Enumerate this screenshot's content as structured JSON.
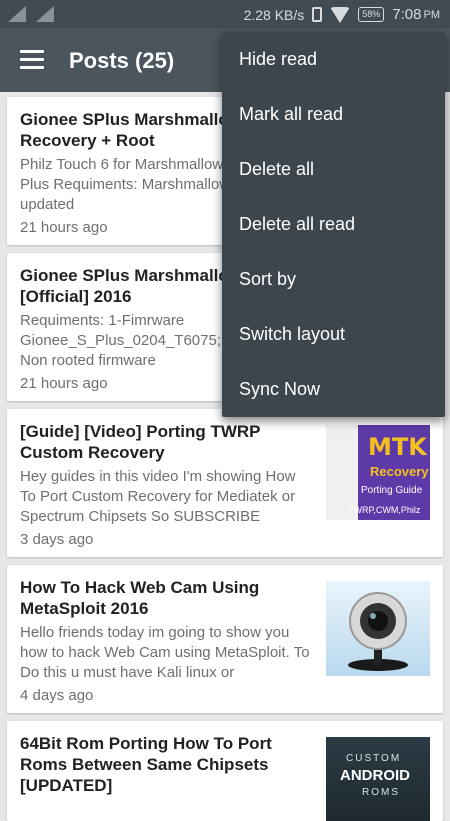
{
  "status_bar": {
    "speed": "2.28 KB/s",
    "battery": "58%",
    "time": "7:08",
    "ampm": "PM"
  },
  "app_bar": {
    "title": "Posts (25)"
  },
  "posts": [
    {
      "title": "Gionee SPlus Marshmallow Touch Recovery + Root",
      "excerpt": "Philz Touch 6 for Marshmallow Gionee S Plus Requiments: Marshmallow device updated",
      "time": "21 hours ago"
    },
    {
      "title": "Gionee SPlus Marshmallow [Official] 2016",
      "excerpt": "Requiments: 1-Fimrware Gionee_S_Plus_0204_T6075; Recovery; 2-Non rooted firmware",
      "time": "21 hours ago"
    },
    {
      "title": "[Guide] [Video] Porting TWRP Custom Recovery",
      "excerpt": "Hey guides in this video I'm showing How To Port Custom Recovery for Mediatek or Spectrum Chipsets So SUBSCRIBE",
      "time": "3 days ago",
      "thumb": {
        "line1": "MTK",
        "line2": "Recovery",
        "line3": "Porting Guide",
        "line4": "TWRP,CWM,Philz"
      }
    },
    {
      "title": "How To Hack Web Cam Using MetaSploit 2016",
      "excerpt": "Hello friends today im going to show you how to hack Web Cam using MetaSploit. To Do this u must have Kali linux or",
      "time": "4 days ago",
      "thumb": {
        "icon": "webcam-image"
      }
    },
    {
      "title": "64Bit Rom Porting How To Port Roms Between Same Chipsets [UPDATED]",
      "excerpt": "",
      "time": "",
      "thumb": {
        "line1": "CUSTOM",
        "line2": "ANDROID",
        "line3": "ROMS"
      }
    }
  ],
  "menu": {
    "items": [
      "Hide read",
      "Mark all read",
      "Delete all",
      "Delete all read",
      "Sort by",
      "Switch layout",
      "Sync Now"
    ]
  },
  "colors": {
    "app_bar": "#4a555d",
    "status_bar": "#424b52",
    "menu": "#3d464d",
    "background": "#e6e7e9"
  }
}
